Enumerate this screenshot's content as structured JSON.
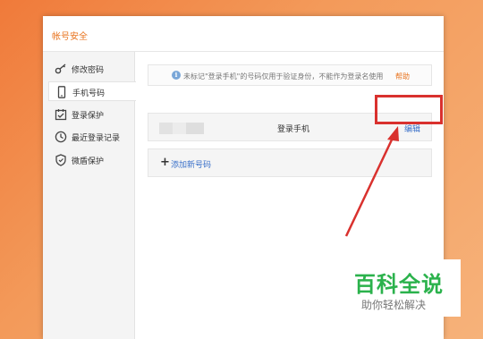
{
  "window": {
    "title": "帐号安全"
  },
  "sidebar": {
    "items": [
      {
        "label": "修改密码",
        "icon": "key-icon"
      },
      {
        "label": "手机号码",
        "icon": "phone-icon",
        "active": true
      },
      {
        "label": "登录保护",
        "icon": "calendar-check-icon"
      },
      {
        "label": "最近登录记录",
        "icon": "clock-icon"
      },
      {
        "label": "微盾保护",
        "icon": "shield-icon"
      }
    ]
  },
  "main": {
    "notice": {
      "text": "未标记\"登录手机\"的号码仅用于验证身份，不能作为登录名使用",
      "help": "帮助",
      "icon": "info-icon"
    },
    "phone_row": {
      "label": "登录手机",
      "edit": "编辑"
    },
    "add_row": {
      "label": "添加新号码",
      "icon": "plus-icon"
    }
  },
  "watermark": {
    "title": "百科全说",
    "subtitle": "助你轻松解决"
  },
  "colors": {
    "accent": "#e8731e",
    "link": "#3a70c9",
    "highlight": "#d9312e",
    "watermark": "#2bb24c"
  }
}
